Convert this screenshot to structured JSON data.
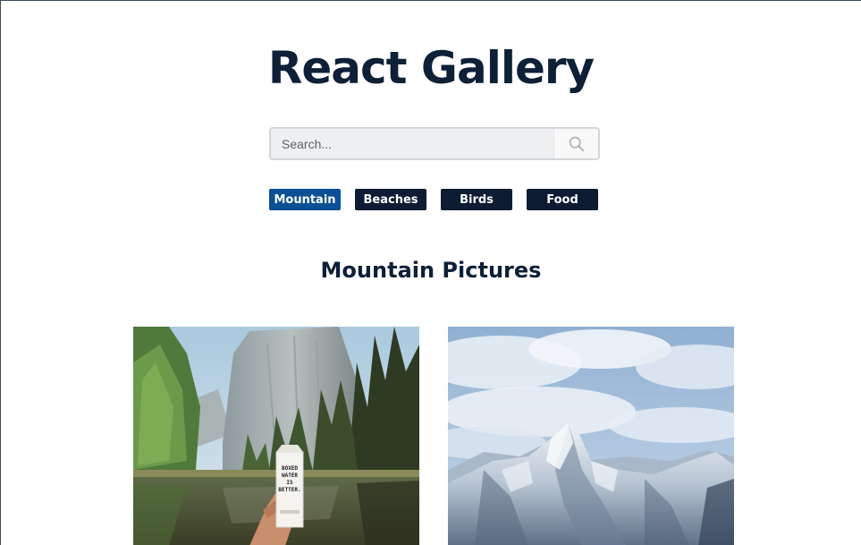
{
  "header": {
    "title": "React Gallery"
  },
  "search": {
    "placeholder": "Search...",
    "value": "",
    "button_icon": "search-icon"
  },
  "nav": {
    "items": [
      {
        "label": "Mountain",
        "active": true
      },
      {
        "label": "Beaches",
        "active": false
      },
      {
        "label": "Birds",
        "active": false
      },
      {
        "label": "Food",
        "active": false
      }
    ]
  },
  "gallery": {
    "heading": "Mountain Pictures",
    "photos": [
      {
        "label": "BOXED WATER IS BETTER."
      },
      {
        "label": ""
      }
    ]
  },
  "colors": {
    "primary_dark": "#0d1c33",
    "active_blue": "#0b4f94",
    "title_text": "#0d2038"
  }
}
